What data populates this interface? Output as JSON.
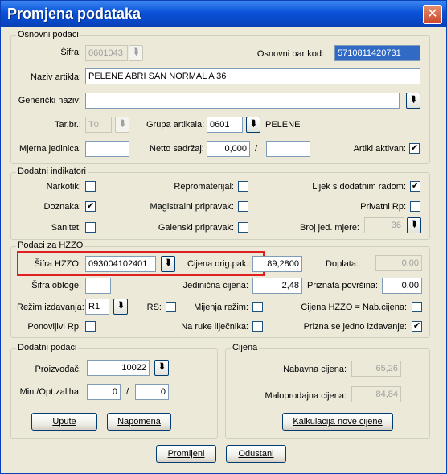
{
  "window": {
    "title": "Promjena podataka",
    "close": "✕"
  },
  "osnovni": {
    "group": "Osnovni podaci",
    "sifra_label": "Šifra:",
    "sifra_value": "0601043",
    "barkod_label": "Osnovni bar kod:",
    "barkod_value": "5710811420731",
    "naziv_label": "Naziv artikla:",
    "naziv_value": "PELENE ABRI SAN NORMAL A 36",
    "genericki_label": "Generički naziv:",
    "genericki_value": "",
    "tarbr_label": "Tar.br.:",
    "tarbr_value": "T0",
    "grupa_label": "Grupa artikala:",
    "grupa_value": "0601",
    "grupa_name": "PELENE",
    "mjera_label": "Mjerna jedinica:",
    "mjera_value": "",
    "netto_label": "Netto sadržaj:",
    "netto_value": "0,000",
    "netto_sep": "/",
    "netto_unit": "",
    "aktivan_label": "Artikl aktivan:",
    "aktivan_checked": true
  },
  "indikatori": {
    "group": "Dodatni indikatori",
    "narkotik": "Narkotik:",
    "doznaka": "Doznaka:",
    "sanitet": "Sanitet:",
    "repromaterijal": "Repromaterijal:",
    "magistralni": "Magistralni pripravak:",
    "galenski": "Galenski pripravak:",
    "lijek": "Lijek s dodatnim radom:",
    "privatni": "Privatni Rp:",
    "broj_label": "Broj jed. mjere:",
    "broj_value": "36",
    "doznaka_checked": true,
    "lijek_checked": true
  },
  "hzzo": {
    "group": "Podaci za HZZO",
    "sifra_label": "Šifra HZZO:",
    "sifra_value": "093004102401",
    "cijena_label": "Cijena orig.pak.:",
    "cijena_value": "89,2800",
    "doplata_label": "Doplata:",
    "doplata_value": "0,00",
    "obloge_label": "Šifra obloge:",
    "obloge_value": "",
    "jedinicna_label": "Jedinična cijena:",
    "jedinicna_value": "2,48",
    "povrsina_label": "Priznata površina:",
    "povrsina_value": "0,00",
    "rezim_label": "Režim izdavanja:",
    "rezim_value": "R1",
    "rs_label": "RS:",
    "mijenja_label": "Mijenja režim:",
    "nab_label": "Cijena HZZO = Nab.cijena:",
    "ponovljivi_label": "Ponovljivi Rp:",
    "naruke_label": "Na ruke liječnika:",
    "prizna_label": "Prizna se jedno izdavanje:",
    "prizna_checked": true
  },
  "dodatni": {
    "group": "Dodatni podaci",
    "proizvodjac_label": "Proizvođač:",
    "proizvodjac_value": "10022",
    "zaliha_label": "Min./Opt.zaliha:",
    "zaliha_min": "0",
    "zaliha_sep": "/",
    "zaliha_opt": "0",
    "upute": "Upute",
    "napomena": "Napomena"
  },
  "cijena": {
    "group": "Cijena",
    "nabavna_label": "Nabavna cijena:",
    "nabavna_value": "65,26",
    "maloprodajna_label": "Maloprodajna cijena:",
    "maloprodajna_value": "84,84",
    "kalkulacija": "Kalkulacija nove cijene"
  },
  "footer": {
    "promijeni": "Promijeni",
    "odustani": "Odustani"
  },
  "icons": {
    "lookup": "⮯",
    "check": "✔"
  }
}
